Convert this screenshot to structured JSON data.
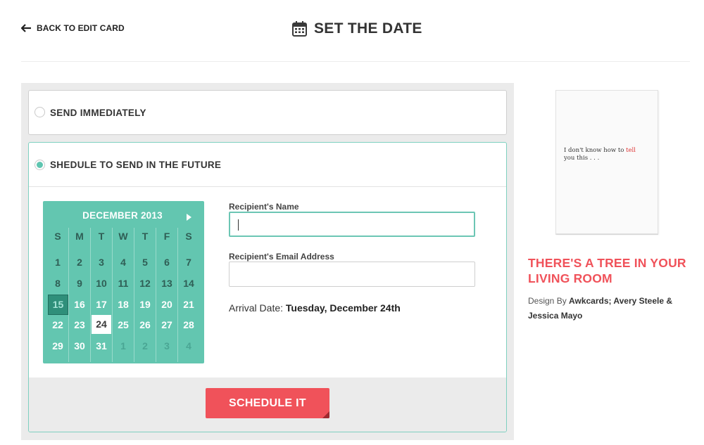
{
  "header": {
    "back_label": "BACK TO EDIT CARD",
    "title": "SET THE DATE"
  },
  "options": {
    "immediately_label": "SEND IMMEDIATELY",
    "schedule_label": "SHEDULE TO SEND IN THE FUTURE",
    "selected": "schedule"
  },
  "calendar": {
    "month_label": "DECEMBER 2013",
    "weekdays": [
      "S",
      "M",
      "T",
      "W",
      "T",
      "F",
      "S"
    ],
    "today": 15,
    "selected": 24,
    "weeks": [
      [
        1,
        2,
        3,
        4,
        5,
        6,
        7
      ],
      [
        8,
        9,
        10,
        11,
        12,
        13,
        14
      ],
      [
        15,
        16,
        17,
        18,
        19,
        20,
        21
      ],
      [
        22,
        23,
        24,
        25,
        26,
        27,
        28
      ],
      [
        29,
        30,
        31,
        1,
        2,
        3,
        4
      ]
    ]
  },
  "form": {
    "name_label": "Recipient's Name",
    "name_value": "",
    "email_label": "Recipient's Email Address",
    "email_value": "",
    "arrival_prefix": "Arrival Date:",
    "arrival_value": "Tuesday, December 24th"
  },
  "button": {
    "schedule_label": "SCHEDULE IT"
  },
  "card": {
    "inside_text_before": "I don't know how to ",
    "inside_text_red": "tell",
    "inside_text_after": "you this . . .",
    "title": "THERE'S A TREE IN YOUR LIVING ROOM",
    "credit_prefix": "Design By ",
    "credit_names": "Awkcards; Avery Steele & Jessica Mayo"
  },
  "colors": {
    "accent_teal": "#63c6b0",
    "accent_red": "#f0525a"
  }
}
